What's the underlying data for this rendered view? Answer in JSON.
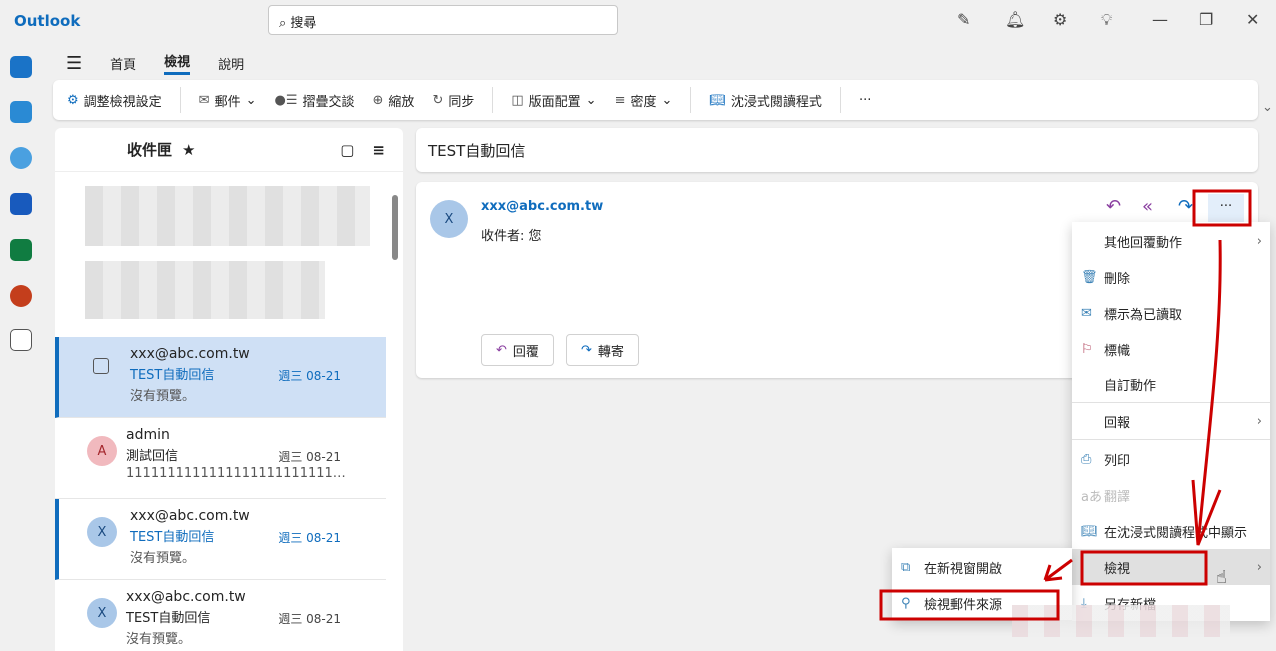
{
  "app": {
    "title": "Outlook",
    "search_placeholder": "搜尋"
  },
  "tabs": [
    "首頁",
    "檢視",
    "說明"
  ],
  "ribbon": [
    "調整檢視設定",
    "郵件",
    "摺疊交談",
    "縮放",
    "同步",
    "版面配置",
    "密度",
    "沈浸式閱讀程式",
    "···"
  ],
  "list": {
    "title": "收件匣",
    "items": [
      {
        "avatar": "",
        "from": "xxx@abc.com.tw",
        "subject": "TEST自動回信",
        "date": "週三 08-21",
        "preview": "沒有預覽。"
      },
      {
        "avatar": "A",
        "from": "admin",
        "subject": "測試回信",
        "date": "週三 08-21",
        "preview": "1111111111111111111111111…"
      },
      {
        "avatar": "X",
        "from": "xxx@abc.com.tw",
        "subject": "TEST自動回信",
        "date": "週三 08-21",
        "preview": "沒有預覽。"
      },
      {
        "avatar": "X",
        "from": "xxx@abc.com.tw",
        "subject": "TEST自動回信",
        "date": "週三 08-21",
        "preview": "沒有預覽。"
      }
    ]
  },
  "reading": {
    "subject": "TEST自動回信",
    "avatar": "X",
    "from": "xxx@abc.com.tw",
    "to": "收件者: 您",
    "reply": "回覆",
    "forward": "轉寄",
    "more": "···"
  },
  "menu": [
    "其他回覆動作",
    "刪除",
    "標示為已讀取",
    "標幟",
    "自訂動作",
    "回報",
    "列印",
    "翻譯",
    "在沈浸式閱讀程式中顯示",
    "檢視",
    "另存新檔"
  ],
  "submenu": [
    "在新視窗開啟",
    "檢視郵件來源"
  ]
}
